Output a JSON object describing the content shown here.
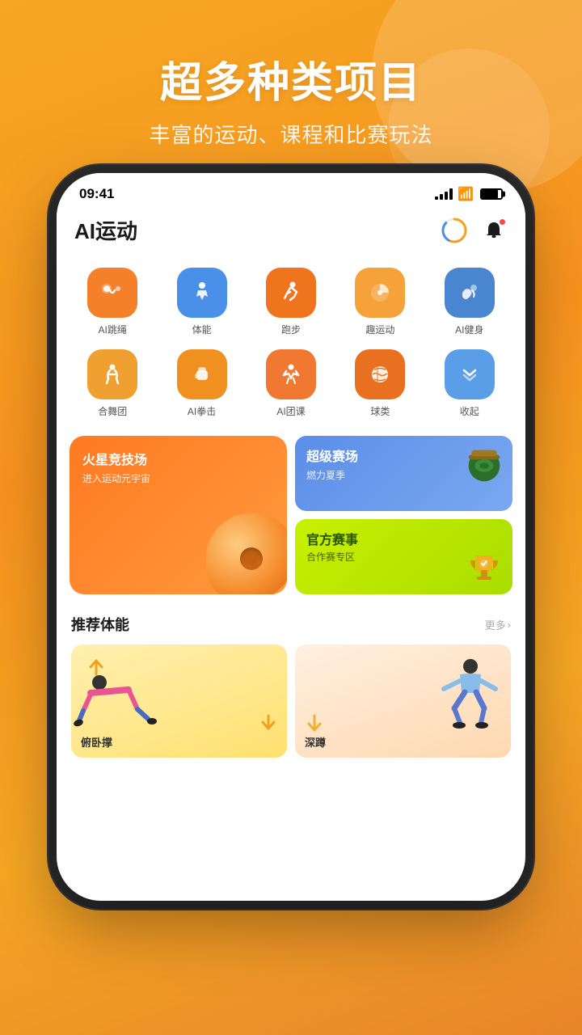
{
  "background": {
    "gradient_start": "#f5a623",
    "gradient_end": "#e8852a"
  },
  "hero": {
    "title": "超多种类项目",
    "subtitle": "丰富的运动、课程和比赛玩法"
  },
  "status_bar": {
    "time": "09:41",
    "signal": "signal-icon",
    "wifi": "wifi-icon",
    "battery": "battery-icon"
  },
  "app_header": {
    "title": "AI运动",
    "progress_icon": "progress-ring-icon",
    "bell_icon": "bell-icon"
  },
  "categories": [
    {
      "id": "jump-rope",
      "label": "AI跳绳",
      "icon": "🤸",
      "color": "icon-orange"
    },
    {
      "id": "fitness",
      "label": "体能",
      "icon": "🏃",
      "color": "icon-blue"
    },
    {
      "id": "running",
      "label": "跑步",
      "icon": "🏃",
      "color": "icon-orange2"
    },
    {
      "id": "fun-sports",
      "label": "趣运动",
      "icon": "🎯",
      "color": "icon-orange3"
    },
    {
      "id": "ai-gym",
      "label": "AI健身",
      "icon": "💪",
      "color": "icon-blue2"
    },
    {
      "id": "dance",
      "label": "合舞团",
      "icon": "💃",
      "color": "icon-orange4"
    },
    {
      "id": "boxing",
      "label": "AI拳击",
      "icon": "🥊",
      "color": "icon-orange5"
    },
    {
      "id": "ai-class",
      "label": "AI团课",
      "icon": "🤺",
      "color": "icon-orange6"
    },
    {
      "id": "ball",
      "label": "球类",
      "icon": "🏀",
      "color": "icon-orange7"
    },
    {
      "id": "collapse",
      "label": "收起",
      "icon": "⌄⌄",
      "color": "icon-blue3"
    }
  ],
  "banners": {
    "left": {
      "title": "火星竞技场",
      "subtitle": "进入运动元宇宙"
    },
    "top_right": {
      "title": "超级赛场",
      "subtitle": "燃力夏季"
    },
    "bottom_right": {
      "title": "官方赛事",
      "subtitle": "合作赛专区"
    }
  },
  "recommended": {
    "title": "推荐体能",
    "more_label": "更多",
    "chevron": "›",
    "items": [
      {
        "id": "pushup",
        "title": "俯卧撑"
      },
      {
        "id": "squat",
        "title": "深蹲"
      }
    ]
  }
}
